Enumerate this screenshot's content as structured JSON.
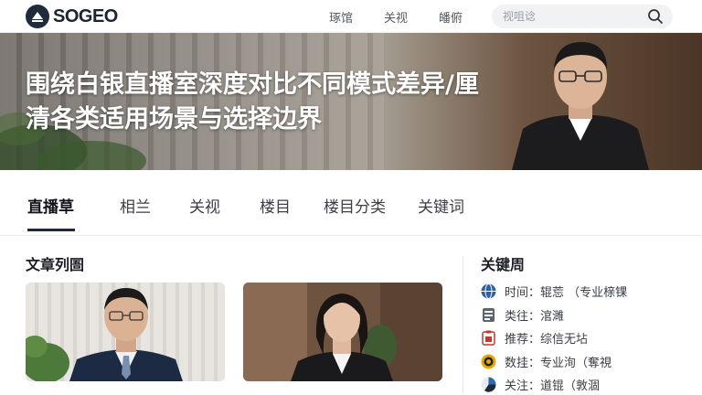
{
  "brand": {
    "name": "SOGEO"
  },
  "nav": {
    "items": [
      "琢馆",
      "关视",
      "皤俯"
    ]
  },
  "search": {
    "placeholder": "视咀谂"
  },
  "hero": {
    "title": "围绕白银直播室深度对比不同模式差异/厘清各类适用场景与选择边界"
  },
  "tabs": {
    "items": [
      "直播草",
      "相兰",
      "关视",
      "楼目",
      "楼目分类",
      "关键词"
    ],
    "active_index": 0
  },
  "articles": {
    "title": "文章列圄"
  },
  "keywords": {
    "title": "关键周",
    "items": [
      {
        "label": "时间：辊莣 （专业榇锞",
        "icon": "globe-icon",
        "color": "#2d5fa6"
      },
      {
        "label": "类往：涫濉",
        "icon": "document-icon",
        "color": "#5b6470"
      },
      {
        "label": "推荐：综信无坫",
        "icon": "clipboard-icon",
        "color": "#c0392b"
      },
      {
        "label": "数挂：专业洵（奪視",
        "icon": "coin-icon",
        "color": "#e0a800"
      },
      {
        "label": "关注：道锟（敦涸",
        "icon": "pie-icon",
        "color": "#2b6cb0"
      }
    ]
  },
  "colors": {
    "brand_dark": "#1f2a3a",
    "hero_text": "#ffffff"
  }
}
